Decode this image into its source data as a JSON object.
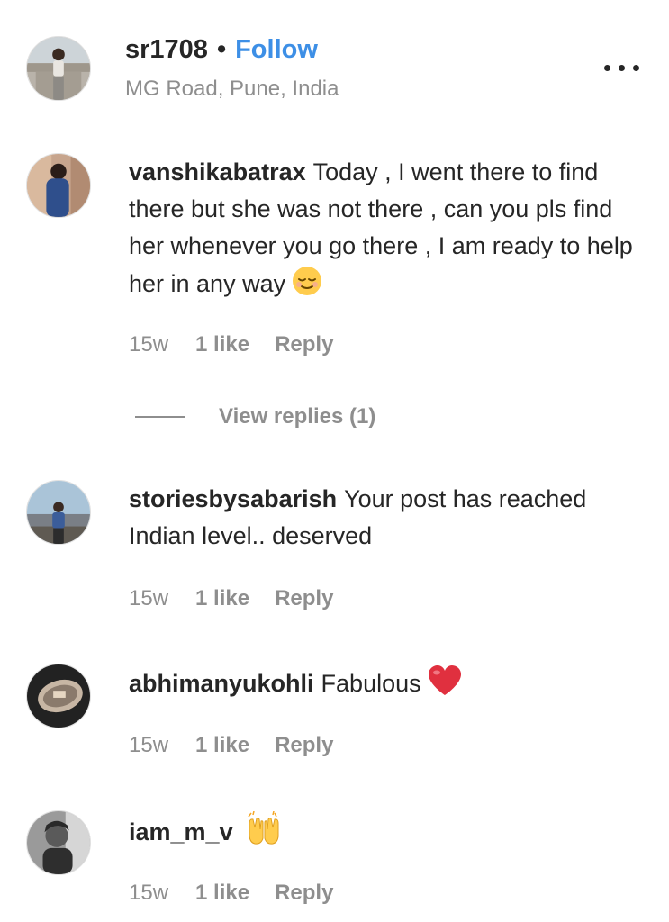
{
  "post_header": {
    "username": "sr1708",
    "separator": "•",
    "follow_label": "Follow",
    "location": "MG Road, Pune, India",
    "more_icon": "more-options-icon"
  },
  "comments": [
    {
      "username": "vanshikabatrax",
      "text": "Today , I went there to find there but she was not there , can you pls find her whenever you go there , I am ready to help her in any way",
      "emoji": "relieved-face-emoji",
      "time": "15w",
      "likes": "1 like",
      "reply_label": "Reply",
      "view_replies_label": "View replies (1)"
    },
    {
      "username": "storiesbysabarish",
      "text": "Your post has reached Indian level.. deserved",
      "emoji": "",
      "time": "15w",
      "likes": "1 like",
      "reply_label": "Reply"
    },
    {
      "username": "abhimanyukohli",
      "text": "Fabulous",
      "emoji": "red-heart-emoji",
      "time": "15w",
      "likes": "1 like",
      "reply_label": "Reply"
    },
    {
      "username": "iam_m_v",
      "text": "",
      "emoji": "raising-hands-emoji",
      "time": "15w",
      "likes": "1 like",
      "reply_label": "Reply"
    }
  ],
  "colors": {
    "follow": "#3d8fe6",
    "muted_text": "#8e8e8e",
    "primary_text": "#262626",
    "divider": "#e6e6e6"
  }
}
